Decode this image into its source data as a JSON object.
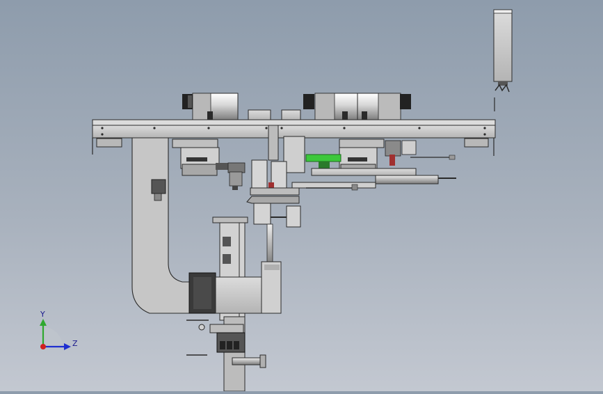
{
  "triad": {
    "y_label": "Y",
    "z_label": "Z",
    "colors": {
      "y": "#2fa82f",
      "z": "#1f2fd0",
      "origin": "#d02020"
    }
  },
  "colors": {
    "background_top": "#8e9cac",
    "background_bottom": "#c3c8d1",
    "metal": "#c8c8c8",
    "metal_dark": "#8a8a8a",
    "outline": "#2a2a2a",
    "accent_green": "#3cc83c",
    "accent_red": "#a03030"
  }
}
